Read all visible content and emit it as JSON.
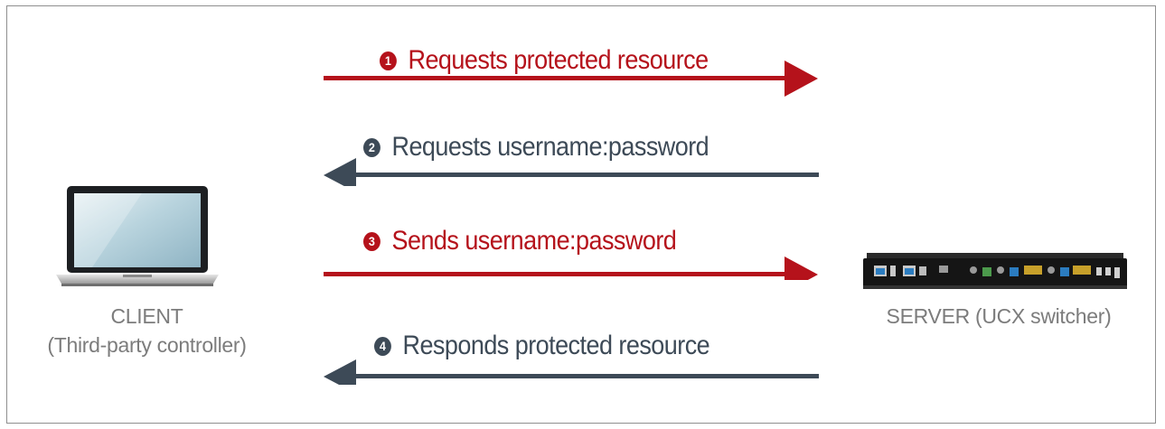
{
  "colors": {
    "request": "#b5121b",
    "response": "#3d4a57",
    "frame": "#8f8f8f",
    "caption": "#7c7c7c"
  },
  "messages": [
    {
      "step": "1",
      "text": "Requests protected resource",
      "direction": "to-server",
      "color": "#b5121b"
    },
    {
      "step": "2",
      "text": "Requests username:password",
      "direction": "to-client",
      "color": "#3d4a57"
    },
    {
      "step": "3",
      "text": "Sends username:password",
      "direction": "to-server",
      "color": "#b5121b"
    },
    {
      "step": "4",
      "text": "Responds protected resource",
      "direction": "to-client",
      "color": "#3d4a57"
    }
  ],
  "client": {
    "line1": "CLIENT",
    "line2": "(Third-party controller)",
    "icon": "laptop-icon"
  },
  "server": {
    "label": "SERVER (UCX switcher)",
    "icon": "switcher-device-icon"
  }
}
